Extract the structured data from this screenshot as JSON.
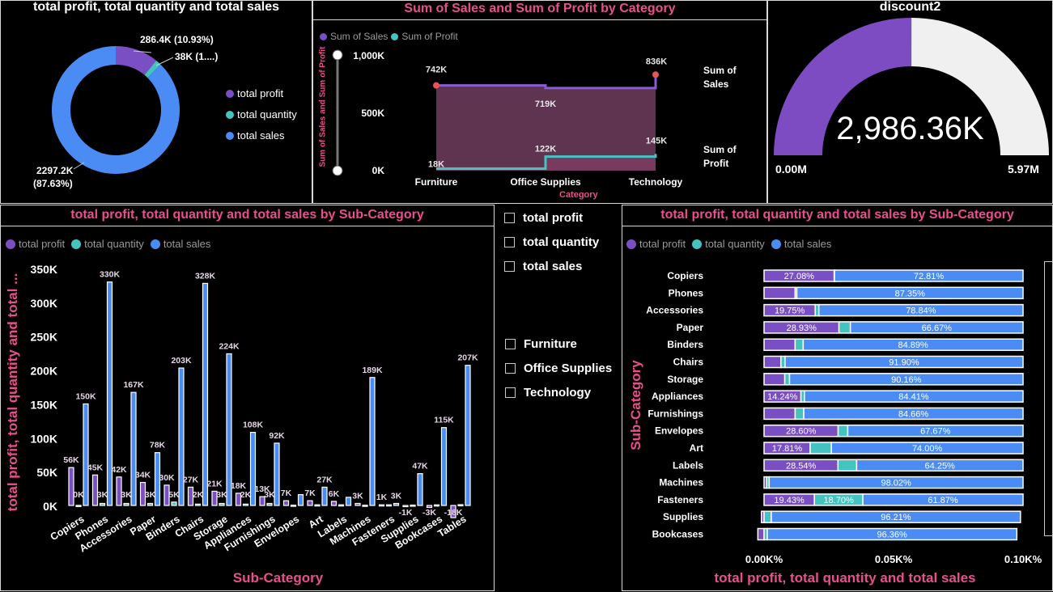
{
  "colors": {
    "profit": "#7b4fc4",
    "quantity": "#45c3c0",
    "sales": "#4a8cf4",
    "title_pink": "#e8508d"
  },
  "donut": {
    "title": "total profit, total quantity and total sales",
    "legend": [
      "total profit",
      "total quantity",
      "total sales"
    ],
    "label_profit": "286.4K (10.93%)",
    "label_quantity": "38K (1....)",
    "label_sales_1": "2297.2K",
    "label_sales_2": "(87.63%)"
  },
  "line": {
    "title": "Sum of Sales and Sum of Profit by Category",
    "legend": [
      "Sum of Sales",
      "Sum of Profit"
    ],
    "ylabel": "Sum of Sales and Sum of Profit",
    "xlabel": "Category",
    "yticks": [
      "1,000K",
      "500K",
      "0K"
    ],
    "sales_labels": [
      "742K",
      "719K",
      "836K"
    ],
    "profit_labels": [
      "18K",
      "122K",
      "145K"
    ],
    "end_label_sales_1": "Sum of",
    "end_label_sales_2": "Sales",
    "end_label_profit_1": "Sum of",
    "end_label_profit_2": "Profit"
  },
  "gauge": {
    "title": "discount2",
    "value_label": "2,986.36K",
    "min_label": "0.00M",
    "max_label": "5.97M"
  },
  "bar": {
    "title": "total profit, total quantity and total sales by Sub-Category",
    "legend": [
      "total profit",
      "total quantity",
      "total sales"
    ],
    "ylabel": "total profit, total quantity and total ...",
    "xlabel": "Sub-Category",
    "yticks": [
      "350K",
      "300K",
      "250K",
      "200K",
      "150K",
      "100K",
      "50K",
      "0K"
    ]
  },
  "slicer": {
    "measures": [
      "total profit",
      "total quantity",
      "total sales"
    ],
    "categories": [
      "Furniture",
      "Office Supplies",
      "Technology"
    ]
  },
  "stacked": {
    "title": "total profit, total quantity and total sales by Sub-Category",
    "legend": [
      "total profit",
      "total quantity",
      "total sales"
    ],
    "ylabel": "Sub-Category",
    "xlabel": "total profit, total quantity and total sales",
    "xticks": [
      "0.00K%",
      "0.05K%",
      "0.10K%"
    ]
  },
  "chart_data": [
    {
      "type": "pie",
      "title": "total profit, total quantity and total sales",
      "categories": [
        "total profit",
        "total quantity",
        "total sales"
      ],
      "values": [
        286.4,
        38,
        2297.2
      ],
      "percents": [
        10.93,
        1.44,
        87.63
      ]
    },
    {
      "type": "line",
      "title": "Sum of Sales and Sum of Profit by Category",
      "categories": [
        "Furniture",
        "Office Supplies",
        "Technology"
      ],
      "series": [
        {
          "name": "Sum of Sales",
          "values": [
            742,
            719,
            836
          ]
        },
        {
          "name": "Sum of Profit",
          "values": [
            18,
            122,
            145
          ]
        }
      ],
      "xlabel": "Category",
      "ylabel": "Sum of Sales and Sum of Profit",
      "ylim": [
        0,
        1000
      ]
    },
    {
      "type": "bar",
      "title": "total profit, total quantity and total sales by Sub-Category",
      "categories": [
        "Copiers",
        "Phones",
        "Accessories",
        "Paper",
        "Binders",
        "Chairs",
        "Storage",
        "Appliances",
        "Furnishings",
        "Envelopes",
        "Art",
        "Labels",
        "Machines",
        "Fasteners",
        "Supplies",
        "Bookcases",
        "Tables"
      ],
      "series": [
        {
          "name": "total profit",
          "values": [
            56,
            45,
            42,
            34,
            30,
            27,
            21,
            18,
            13,
            7,
            7,
            6,
            3,
            1,
            -1,
            -3,
            -18
          ],
          "labels": [
            "56K",
            "45K",
            "42K",
            "34K",
            "30K",
            "27K",
            "21K",
            "18K",
            "13K",
            "7K",
            "7K",
            "6K",
            "3K",
            "1K",
            "-1K",
            "-3K",
            "-18K"
          ]
        },
        {
          "name": "total quantity",
          "values": [
            0.2,
            3,
            3,
            3,
            5,
            2,
            3,
            2,
            3,
            0.5,
            1,
            1,
            0.4,
            1,
            0.6,
            0.9,
            1.2
          ],
          "labels": [
            "0K",
            "3K",
            "3K",
            "3K",
            "5K",
            "2K",
            "3K",
            "2K",
            "3K",
            "",
            "",
            "",
            "",
            "",
            "",
            "",
            ""
          ]
        },
        {
          "name": "total sales",
          "values": [
            150,
            330,
            167,
            78,
            203,
            328,
            224,
            108,
            92,
            16,
            27,
            12,
            189,
            3,
            47,
            115,
            207
          ],
          "labels": [
            "150K",
            "330K",
            "167K",
            "78K",
            "203K",
            "328K",
            "224K",
            "108K",
            "92K",
            "",
            "27K",
            "",
            "189K",
            "3K",
            "47K",
            "115K",
            "207K"
          ]
        }
      ],
      "xlabel": "Sub-Category",
      "ylabel": "total profit, total quantity and total ...",
      "ylim": [
        0,
        350
      ]
    },
    {
      "type": "bar",
      "title": "total profit, total quantity and total sales by Sub-Category",
      "stacked": true,
      "categories": [
        "Copiers",
        "Phones",
        "Accessories",
        "Paper",
        "Binders",
        "Chairs",
        "Storage",
        "Appliances",
        "Furnishings",
        "Envelopes",
        "Art",
        "Labels",
        "Machines",
        "Fasteners",
        "Supplies",
        "Bookcases"
      ],
      "series": [
        {
          "name": "total profit",
          "values": [
            27.08,
            12.0,
            19.75,
            28.93,
            12.0,
            6.5,
            8.0,
            14.24,
            12.0,
            28.6,
            17.81,
            28.54,
            1.0,
            19.43,
            -1.0,
            -2.4
          ]
        },
        {
          "name": "total quantity",
          "values": [
            0.11,
            0.65,
            1.41,
            4.4,
            3.11,
            1.6,
            1.84,
            1.35,
            3.34,
            3.73,
            8.19,
            7.21,
            0.98,
            18.7,
            2.79,
            1.24
          ]
        },
        {
          "name": "total sales",
          "values": [
            72.81,
            87.35,
            78.84,
            66.67,
            84.89,
            91.9,
            90.16,
            84.41,
            84.66,
            67.67,
            74.0,
            64.25,
            98.02,
            61.87,
            96.21,
            96.36
          ]
        }
      ],
      "value_labels": {
        "profit": [
          "27.08%",
          "",
          "19.75%",
          "28.93%",
          "",
          "",
          "",
          "14.24%",
          "",
          "28.60%",
          "17.81%",
          "28.54%",
          "",
          "19.43%",
          "",
          ""
        ],
        "quantity": [
          "",
          "",
          "",
          "",
          "",
          "",
          "",
          "",
          "",
          "",
          "",
          "",
          "",
          "18.70%",
          "",
          ""
        ],
        "sales": [
          "72.81%",
          "87.35%",
          "78.84%",
          "66.67%",
          "84.89%",
          "91.90%",
          "90.16%",
          "84.41%",
          "84.66%",
          "67.67%",
          "74.00%",
          "64.25%",
          "98.02%",
          "61.87%",
          "96.21%",
          "96.36%"
        ]
      },
      "xlabel": "total profit, total quantity and total sales",
      "ylabel": "Sub-Category"
    },
    {
      "type": "gauge",
      "title": "discount2",
      "value": 2986.36,
      "min": 0,
      "max": 5970,
      "value_label": "2,986.36K"
    }
  ]
}
